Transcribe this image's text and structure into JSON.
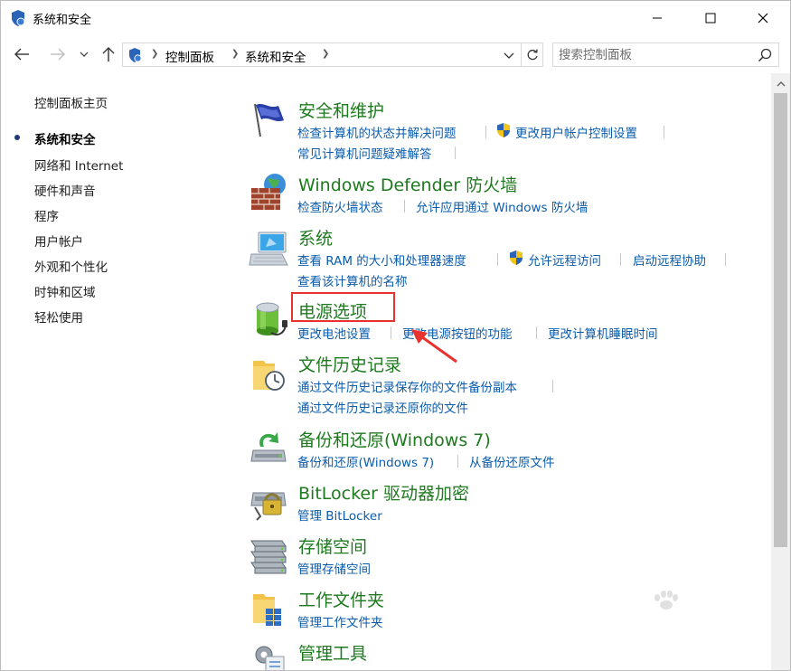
{
  "window": {
    "title": "系统和安全"
  },
  "nav": {
    "breadcrumb": [
      "控制面板",
      "系统和安全"
    ],
    "search_placeholder": "搜索控制面板"
  },
  "sidebar": {
    "home": "控制面板主页",
    "items": [
      {
        "label": "系统和安全",
        "active": true
      },
      {
        "label": "网络和 Internet",
        "active": false
      },
      {
        "label": "硬件和声音",
        "active": false
      },
      {
        "label": "程序",
        "active": false
      },
      {
        "label": "用户帐户",
        "active": false
      },
      {
        "label": "外观和个性化",
        "active": false
      },
      {
        "label": "时钟和区域",
        "active": false
      },
      {
        "label": "轻松使用",
        "active": false
      }
    ]
  },
  "categories": [
    {
      "title": "安全和维护",
      "icon": "flag-icon",
      "links": [
        "检查计算机的状态并解决问题",
        "更改用户帐户控制设置",
        "常见计算机问题疑难解答"
      ]
    },
    {
      "title": "Windows Defender 防火墙",
      "icon": "firewall-icon",
      "links": [
        "检查防火墙状态",
        "允许应用通过 Windows 防火墙"
      ]
    },
    {
      "title": "系统",
      "icon": "computer-icon",
      "links": [
        "查看 RAM 的大小和处理器速度",
        "允许远程访问",
        "启动远程协助",
        "查看该计算机的名称"
      ]
    },
    {
      "title": "电源选项",
      "icon": "battery-icon",
      "links": [
        "更改电池设置",
        "更改电源按钮的功能",
        "更改计算机睡眠时间"
      ]
    },
    {
      "title": "文件历史记录",
      "icon": "file-history-icon",
      "links": [
        "通过文件历史记录保存你的文件备份副本",
        "通过文件历史记录还原你的文件"
      ]
    },
    {
      "title": "备份和还原(Windows 7)",
      "icon": "backup-icon",
      "links": [
        "备份和还原(Windows 7)",
        "从备份还原文件"
      ]
    },
    {
      "title": "BitLocker 驱动器加密",
      "icon": "bitlocker-icon",
      "links": [
        "管理 BitLocker"
      ]
    },
    {
      "title": "存储空间",
      "icon": "storage-icon",
      "links": [
        "管理存储空间"
      ]
    },
    {
      "title": "工作文件夹",
      "icon": "work-folders-icon",
      "links": [
        "管理工作文件夹"
      ]
    },
    {
      "title": "管理工具",
      "icon": "admin-tools-icon",
      "links": []
    }
  ],
  "colors": {
    "category_title": "#1e7a1e",
    "link": "#0b5cad",
    "highlight": "#e8322f"
  }
}
